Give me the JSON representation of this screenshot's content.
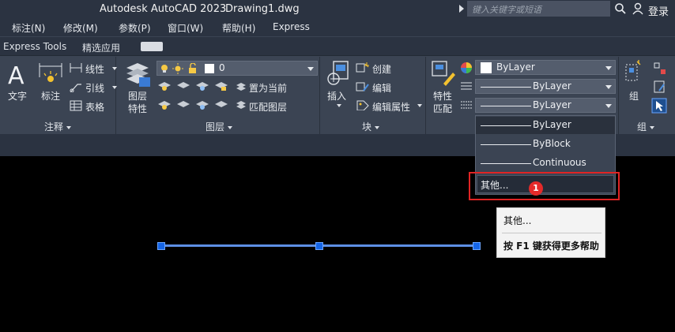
{
  "title": {
    "app": "Autodesk AutoCAD 2023",
    "doc": "Drawing1.dwg"
  },
  "search": {
    "placeholder": "键入关键字或短语",
    "login": "登录"
  },
  "menu": [
    "标注(N)",
    "修改(M)",
    "参数(P)",
    "窗口(W)",
    "帮助(H)",
    "Express"
  ],
  "tabs": [
    "Express Tools",
    "精选应用"
  ],
  "annotation_panel": {
    "text_label": "文字",
    "dim_label": "标注",
    "linear": "线性",
    "leader": "引线",
    "table": "表格",
    "title": "注释"
  },
  "layer_panel": {
    "layer_props_1": "图层",
    "layer_props_2": "特性",
    "current_layer": "0",
    "set_current": "置为当前",
    "match_layer": "匹配图层",
    "title": "图层"
  },
  "block_panel": {
    "insert": "插入",
    "create": "创建",
    "edit": "编辑",
    "edit_attr": "编辑属性",
    "title": "块"
  },
  "properties_panel": {
    "match_1": "特性",
    "match_2": "匹配",
    "color": "ByLayer",
    "linetype": "ByLayer",
    "lineweight": "ByLayer"
  },
  "group_panel": {
    "label": "组",
    "title": "组"
  },
  "linetype_dropdown": {
    "items": [
      "ByLayer",
      "ByBlock",
      "Continuous"
    ],
    "other": "其他..."
  },
  "badge": "1",
  "tooltip": {
    "title": "其他...",
    "help": "按 F1 键获得更多帮助"
  },
  "colors": {
    "ribbon": "#3b4453",
    "titlebar": "#2b3341",
    "highlight": "#e02424",
    "grip": "#1565e6"
  }
}
